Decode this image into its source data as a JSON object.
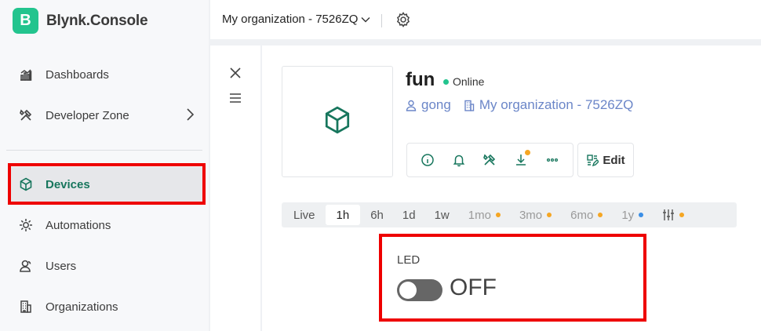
{
  "brand": {
    "logo_letter": "B",
    "name": "Blynk.Console"
  },
  "sidebar": {
    "items": [
      {
        "label": "Dashboards",
        "icon": "dashboard-chart-icon"
      },
      {
        "label": "Developer Zone",
        "icon": "tools-icon"
      },
      {
        "label": "Devices",
        "icon": "cube-icon",
        "active": true
      },
      {
        "label": "Automations",
        "icon": "sun-gear-icon"
      },
      {
        "label": "Users",
        "icon": "users-icon"
      },
      {
        "label": "Organizations",
        "icon": "building-icon"
      }
    ]
  },
  "topbar": {
    "org_name": "My organization - 7526ZQ"
  },
  "device": {
    "name": "fun",
    "status": "Online",
    "owner": "gong",
    "organization": "My organization - 7526ZQ",
    "edit_label": "Edit"
  },
  "time_ranges": [
    {
      "label": "Live"
    },
    {
      "label": "1h",
      "active": true
    },
    {
      "label": "6h"
    },
    {
      "label": "1d"
    },
    {
      "label": "1w"
    },
    {
      "label": "1mo",
      "premium": true,
      "dot": "#f5a623"
    },
    {
      "label": "3mo",
      "premium": true,
      "dot": "#f5a623"
    },
    {
      "label": "6mo",
      "premium": true,
      "dot": "#f5a623"
    },
    {
      "label": "1y",
      "premium": true,
      "dot": "#3a8ee6"
    }
  ],
  "led": {
    "label": "LED",
    "state": "OFF"
  },
  "colors": {
    "accent": "#23c48e",
    "link": "#6b86c8",
    "highlight": "#ee0000",
    "premium_dot": "#f5a623"
  }
}
